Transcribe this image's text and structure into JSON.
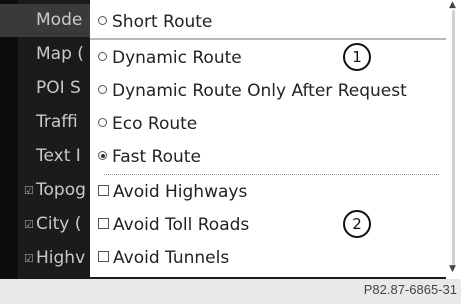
{
  "background_menu": {
    "items": [
      {
        "label": "Mode",
        "checked": false
      },
      {
        "label": "Map (",
        "checked": false
      },
      {
        "label": "POI S",
        "checked": false
      },
      {
        "label": "Traffi",
        "checked": false
      },
      {
        "label": "Text I",
        "checked": false
      },
      {
        "label": "Topog",
        "checked": true
      },
      {
        "label": "City (",
        "checked": true
      },
      {
        "label": "Highv",
        "checked": true
      }
    ]
  },
  "popup": {
    "route_options": [
      {
        "label": "Short Route",
        "selected": false
      },
      {
        "label": "Dynamic Route",
        "selected": false
      },
      {
        "label": "Dynamic Route Only After Request",
        "selected": false
      },
      {
        "label": "Eco Route",
        "selected": false
      },
      {
        "label": "Fast Route",
        "selected": true
      }
    ],
    "avoid_options": [
      {
        "label": "Avoid Highways",
        "checked": false
      },
      {
        "label": "Avoid Toll Roads",
        "checked": false
      },
      {
        "label": "Avoid Tunnels",
        "checked": false
      }
    ]
  },
  "callouts": [
    "1",
    "2"
  ],
  "figure_ref": "P82.87-6865-31",
  "colors": {
    "popup_bg": "#ffffff",
    "screen_bg": "#1b1b1b",
    "text": "#222222"
  }
}
